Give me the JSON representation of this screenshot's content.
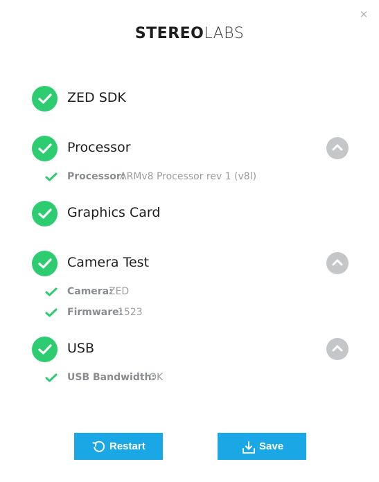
{
  "window": {
    "close_icon": "close-icon",
    "logo": {
      "part1": "STEREO",
      "part2": "LABS"
    }
  },
  "colors": {
    "ok_green": "#2ecc71",
    "collapse_gray": "#c4c6c8",
    "button_blue": "#1aa7e5"
  },
  "sections": {
    "zed_sdk": {
      "title": "ZED SDK",
      "status": "ok"
    },
    "processor": {
      "title": "Processor",
      "status": "ok",
      "expanded": true,
      "details": [
        {
          "label": "Processor:",
          "value": "ARMv8 Processor rev 1 (v8l)"
        }
      ]
    },
    "graphics_card": {
      "title": "Graphics Card",
      "status": "ok"
    },
    "camera_test": {
      "title": "Camera Test",
      "status": "ok",
      "expanded": true,
      "details": [
        {
          "label": "Camera:",
          "value": "ZED"
        },
        {
          "label": "Firmware:",
          "value": "1523"
        }
      ]
    },
    "usb": {
      "title": "USB",
      "status": "ok",
      "expanded": true,
      "details": [
        {
          "label": "USB Bandwidth:",
          "value": "OK"
        }
      ]
    }
  },
  "buttons": {
    "restart": {
      "label": "Restart",
      "icon": "restart-icon"
    },
    "save": {
      "label": "Save",
      "icon": "download-icon"
    }
  }
}
